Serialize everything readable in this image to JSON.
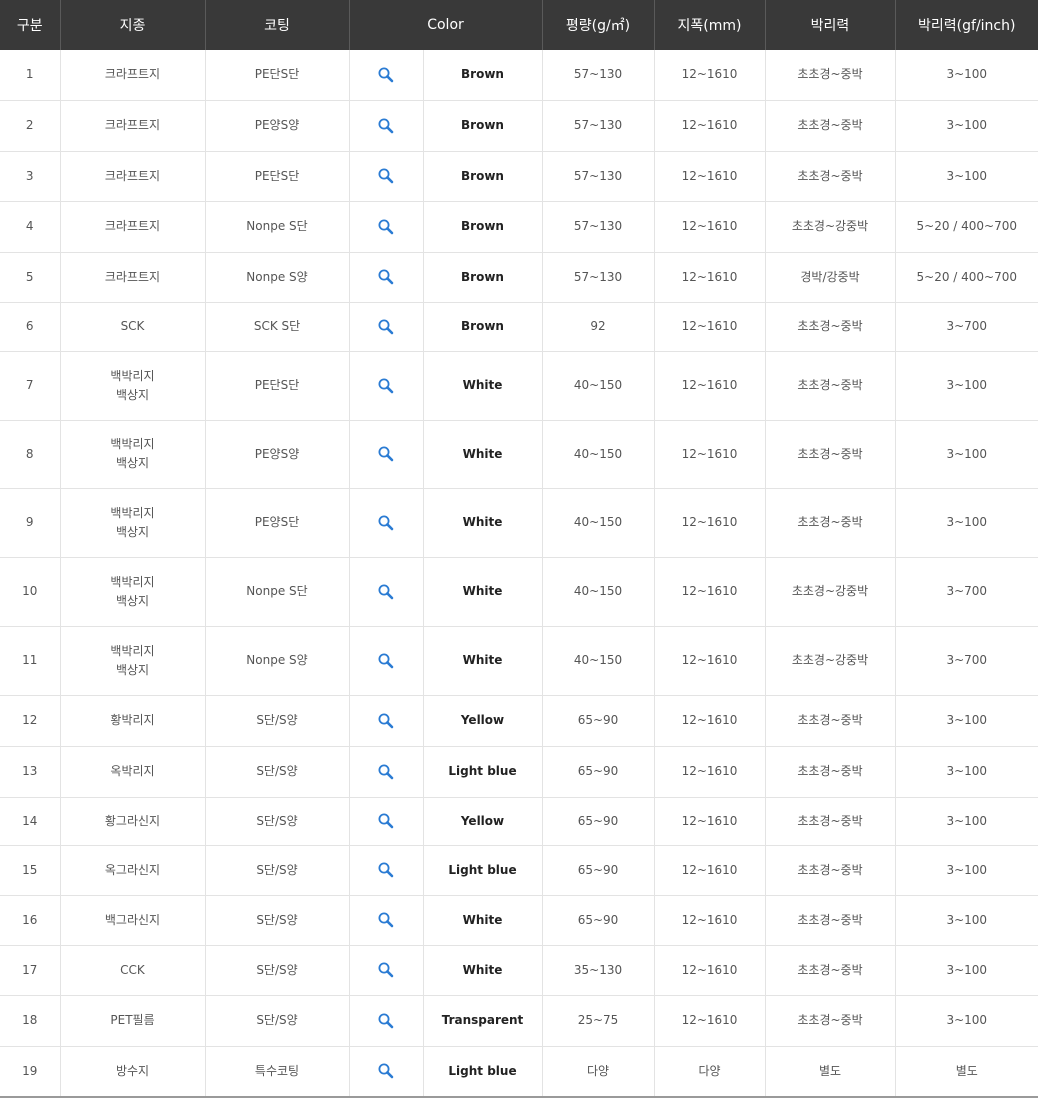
{
  "table": {
    "headers": {
      "no": "구분",
      "paper": "지종",
      "coating": "코팅",
      "color": "Color",
      "weight": "평량(g/㎡)",
      "width": "지폭(mm)",
      "peel": "박리력",
      "peel_force": "박리력(gf/inch)"
    },
    "zoom_icon": "magnifier-icon",
    "accent_color": "#2a7bd3",
    "header_bg": "#393939",
    "rows": [
      {
        "no": "1",
        "paper": [
          "크라프트지"
        ],
        "coating": "PE단S단",
        "color": "Brown",
        "weight": "57~130",
        "width": "12~1610",
        "peel": "초초경~중박",
        "peel_force": "3~100"
      },
      {
        "no": "2",
        "paper": [
          "크라프트지"
        ],
        "coating": "PE양S양",
        "color": "Brown",
        "weight": "57~130",
        "width": "12~1610",
        "peel": "초초경~중박",
        "peel_force": "3~100"
      },
      {
        "no": "3",
        "paper": [
          "크라프트지"
        ],
        "coating": "PE단S단",
        "color": "Brown",
        "weight": "57~130",
        "width": "12~1610",
        "peel": "초초경~중박",
        "peel_force": "3~100"
      },
      {
        "no": "4",
        "paper": [
          "크라프트지"
        ],
        "coating": "Nonpe S단",
        "color": "Brown",
        "weight": "57~130",
        "width": "12~1610",
        "peel": "초초경~강중박",
        "peel_force": "5~20 / 400~700"
      },
      {
        "no": "5",
        "paper": [
          "크라프트지"
        ],
        "coating": "Nonpe S양",
        "color": "Brown",
        "weight": "57~130",
        "width": "12~1610",
        "peel": "경박/강중박",
        "peel_force": "5~20 / 400~700"
      },
      {
        "no": "6",
        "paper": [
          "SCK"
        ],
        "coating": "SCK S단",
        "color": "Brown",
        "weight": "92",
        "width": "12~1610",
        "peel": "초초경~중박",
        "peel_force": "3~700"
      },
      {
        "no": "7",
        "paper": [
          "백박리지",
          "백상지"
        ],
        "coating": "PE단S단",
        "color": "White",
        "weight": "40~150",
        "width": "12~1610",
        "peel": "초초경~중박",
        "peel_force": "3~100"
      },
      {
        "no": "8",
        "paper": [
          "백박리지",
          "백상지"
        ],
        "coating": "PE양S양",
        "color": "White",
        "weight": "40~150",
        "width": "12~1610",
        "peel": "초초경~중박",
        "peel_force": "3~100"
      },
      {
        "no": "9",
        "paper": [
          "백박리지",
          "백상지"
        ],
        "coating": "PE양S단",
        "color": "White",
        "weight": "40~150",
        "width": "12~1610",
        "peel": "초초경~중박",
        "peel_force": "3~100"
      },
      {
        "no": "10",
        "paper": [
          "백박리지",
          "백상지"
        ],
        "coating": "Nonpe S단",
        "color": "White",
        "weight": "40~150",
        "width": "12~1610",
        "peel": "초초경~강중박",
        "peel_force": "3~700"
      },
      {
        "no": "11",
        "paper": [
          "백박리지",
          "백상지"
        ],
        "coating": "Nonpe S양",
        "color": "White",
        "weight": "40~150",
        "width": "12~1610",
        "peel": "초초경~강중박",
        "peel_force": "3~700"
      },
      {
        "no": "12",
        "paper": [
          "황박리지"
        ],
        "coating": "S단/S양",
        "color": "Yellow",
        "weight": "65~90",
        "width": "12~1610",
        "peel": "초초경~중박",
        "peel_force": "3~100"
      },
      {
        "no": "13",
        "paper": [
          "옥박리지"
        ],
        "coating": "S단/S양",
        "color": "Light blue",
        "weight": "65~90",
        "width": "12~1610",
        "peel": "초초경~중박",
        "peel_force": "3~100"
      },
      {
        "no": "14",
        "paper": [
          "황그라신지"
        ],
        "coating": "S단/S양",
        "color": "Yellow",
        "weight": "65~90",
        "width": "12~1610",
        "peel": "초초경~중박",
        "peel_force": "3~100"
      },
      {
        "no": "15",
        "paper": [
          "옥그라신지"
        ],
        "coating": "S단/S양",
        "color": "Light blue",
        "weight": "65~90",
        "width": "12~1610",
        "peel": "초초경~중박",
        "peel_force": "3~100"
      },
      {
        "no": "16",
        "paper": [
          "백그라신지"
        ],
        "coating": "S단/S양",
        "color": "White",
        "weight": "65~90",
        "width": "12~1610",
        "peel": "초초경~중박",
        "peel_force": "3~100"
      },
      {
        "no": "17",
        "paper": [
          "CCK"
        ],
        "coating": "S단/S양",
        "color": "White",
        "weight": "35~130",
        "width": "12~1610",
        "peel": "초초경~중박",
        "peel_force": "3~100"
      },
      {
        "no": "18",
        "paper": [
          "PET필름"
        ],
        "coating": "S단/S양",
        "color": "Transparent",
        "weight": "25~75",
        "width": "12~1610",
        "peel": "초초경~중박",
        "peel_force": "3~100"
      },
      {
        "no": "19",
        "paper": [
          "방수지"
        ],
        "coating": "특수코팅",
        "color": "Light blue",
        "weight": "다양",
        "width": "다양",
        "peel": "별도",
        "peel_force": "별도"
      }
    ]
  }
}
